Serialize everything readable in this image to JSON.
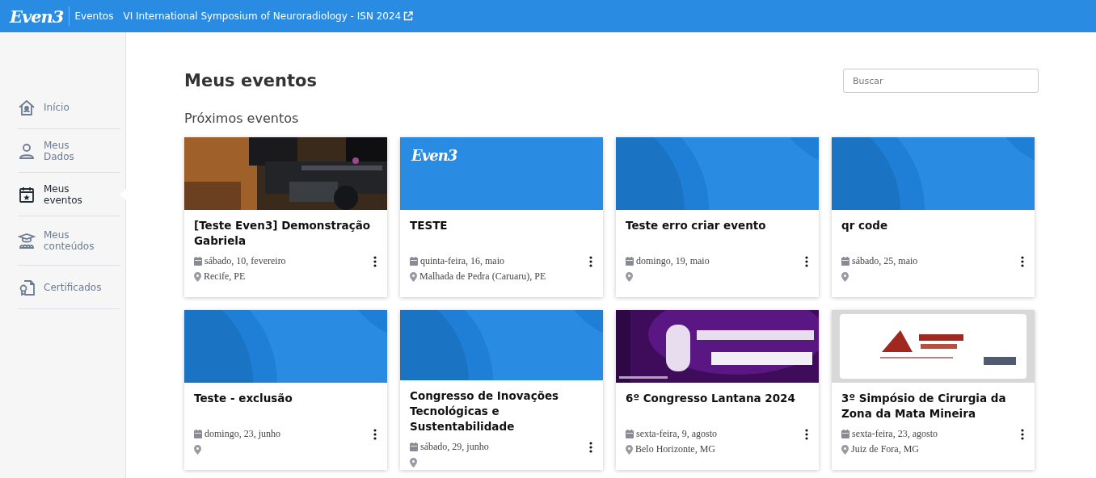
{
  "header": {
    "logo": "Even3",
    "section": "Eventos",
    "event_link": "VI International Symposium of Neuroradiology - ISN 2024"
  },
  "sidebar": {
    "items": [
      {
        "label": "Início",
        "kind": "home",
        "selected": false
      },
      {
        "label": "Meus Dados",
        "kind": "person",
        "selected": false
      },
      {
        "label": "Meus eventos",
        "kind": "calendar",
        "selected": true
      },
      {
        "label": "Meus conteúdos",
        "kind": "course",
        "selected": false
      },
      {
        "label": "Certificados",
        "kind": "certificate",
        "selected": false
      }
    ]
  },
  "page": {
    "title": "Meus eventos",
    "search": {
      "placeholder": "Buscar"
    },
    "section_title": "Próximos eventos"
  },
  "events": [
    {
      "title": "[Teste Even3] Demonstração Gabriela",
      "date": "sábado, 10, fevereiro",
      "location": "Recife, PE"
    },
    {
      "title": "TESTE",
      "date": "quinta-feira, 16, maio",
      "location": "Malhada de Pedra (Caruaru), PE",
      "banner": {
        "kind": "logo",
        "logo": "Even3"
      }
    },
    {
      "title": "Teste erro criar evento",
      "date": "domingo, 19, maio",
      "banner": {
        "kind": "pattern"
      }
    },
    {
      "title": "qr code",
      "date": "sábado, 25, maio",
      "banner": {
        "kind": "pattern"
      }
    },
    {
      "title": "Teste - exclusão",
      "date": "domingo, 23, junho",
      "banner": {
        "kind": "pattern"
      }
    },
    {
      "title": "Congresso de Inovações Tecnológicas e Sustentabilidade",
      "date": "sábado, 29, junho",
      "banner": {
        "kind": "pattern"
      }
    },
    {
      "title": "6º Congresso Lantana 2024",
      "date": "sexta-feira, 9, agosto",
      "location": "Belo Horizonte, MG",
      "banner": {
        "kind": "purple"
      }
    },
    {
      "title": "3º Simpósio de Cirurgia da Zona da Mata Mineira",
      "date": "sexta-feira, 23, agosto",
      "location": "Juiz de Fora, MG",
      "banner": {
        "kind": "poster"
      }
    }
  ]
}
